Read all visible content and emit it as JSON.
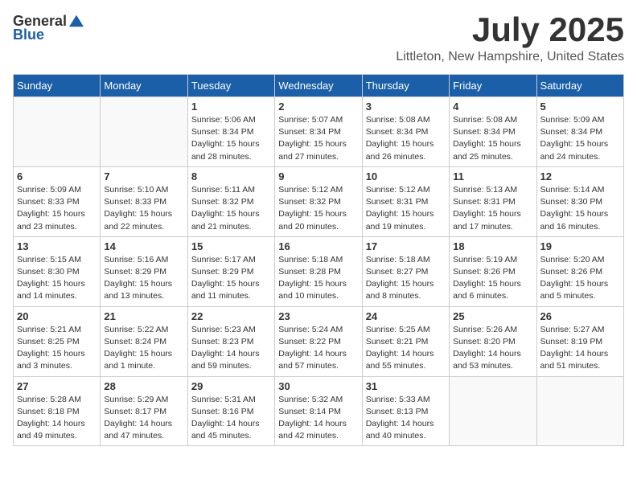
{
  "logo": {
    "general": "General",
    "blue": "Blue"
  },
  "title": "July 2025",
  "location": "Littleton, New Hampshire, United States",
  "weekdays": [
    "Sunday",
    "Monday",
    "Tuesday",
    "Wednesday",
    "Thursday",
    "Friday",
    "Saturday"
  ],
  "weeks": [
    [
      {
        "day": "",
        "info": ""
      },
      {
        "day": "",
        "info": ""
      },
      {
        "day": "1",
        "info": "Sunrise: 5:06 AM\nSunset: 8:34 PM\nDaylight: 15 hours and 28 minutes."
      },
      {
        "day": "2",
        "info": "Sunrise: 5:07 AM\nSunset: 8:34 PM\nDaylight: 15 hours and 27 minutes."
      },
      {
        "day": "3",
        "info": "Sunrise: 5:08 AM\nSunset: 8:34 PM\nDaylight: 15 hours and 26 minutes."
      },
      {
        "day": "4",
        "info": "Sunrise: 5:08 AM\nSunset: 8:34 PM\nDaylight: 15 hours and 25 minutes."
      },
      {
        "day": "5",
        "info": "Sunrise: 5:09 AM\nSunset: 8:34 PM\nDaylight: 15 hours and 24 minutes."
      }
    ],
    [
      {
        "day": "6",
        "info": "Sunrise: 5:09 AM\nSunset: 8:33 PM\nDaylight: 15 hours and 23 minutes."
      },
      {
        "day": "7",
        "info": "Sunrise: 5:10 AM\nSunset: 8:33 PM\nDaylight: 15 hours and 22 minutes."
      },
      {
        "day": "8",
        "info": "Sunrise: 5:11 AM\nSunset: 8:32 PM\nDaylight: 15 hours and 21 minutes."
      },
      {
        "day": "9",
        "info": "Sunrise: 5:12 AM\nSunset: 8:32 PM\nDaylight: 15 hours and 20 minutes."
      },
      {
        "day": "10",
        "info": "Sunrise: 5:12 AM\nSunset: 8:31 PM\nDaylight: 15 hours and 19 minutes."
      },
      {
        "day": "11",
        "info": "Sunrise: 5:13 AM\nSunset: 8:31 PM\nDaylight: 15 hours and 17 minutes."
      },
      {
        "day": "12",
        "info": "Sunrise: 5:14 AM\nSunset: 8:30 PM\nDaylight: 15 hours and 16 minutes."
      }
    ],
    [
      {
        "day": "13",
        "info": "Sunrise: 5:15 AM\nSunset: 8:30 PM\nDaylight: 15 hours and 14 minutes."
      },
      {
        "day": "14",
        "info": "Sunrise: 5:16 AM\nSunset: 8:29 PM\nDaylight: 15 hours and 13 minutes."
      },
      {
        "day": "15",
        "info": "Sunrise: 5:17 AM\nSunset: 8:29 PM\nDaylight: 15 hours and 11 minutes."
      },
      {
        "day": "16",
        "info": "Sunrise: 5:18 AM\nSunset: 8:28 PM\nDaylight: 15 hours and 10 minutes."
      },
      {
        "day": "17",
        "info": "Sunrise: 5:18 AM\nSunset: 8:27 PM\nDaylight: 15 hours and 8 minutes."
      },
      {
        "day": "18",
        "info": "Sunrise: 5:19 AM\nSunset: 8:26 PM\nDaylight: 15 hours and 6 minutes."
      },
      {
        "day": "19",
        "info": "Sunrise: 5:20 AM\nSunset: 8:26 PM\nDaylight: 15 hours and 5 minutes."
      }
    ],
    [
      {
        "day": "20",
        "info": "Sunrise: 5:21 AM\nSunset: 8:25 PM\nDaylight: 15 hours and 3 minutes."
      },
      {
        "day": "21",
        "info": "Sunrise: 5:22 AM\nSunset: 8:24 PM\nDaylight: 15 hours and 1 minute."
      },
      {
        "day": "22",
        "info": "Sunrise: 5:23 AM\nSunset: 8:23 PM\nDaylight: 14 hours and 59 minutes."
      },
      {
        "day": "23",
        "info": "Sunrise: 5:24 AM\nSunset: 8:22 PM\nDaylight: 14 hours and 57 minutes."
      },
      {
        "day": "24",
        "info": "Sunrise: 5:25 AM\nSunset: 8:21 PM\nDaylight: 14 hours and 55 minutes."
      },
      {
        "day": "25",
        "info": "Sunrise: 5:26 AM\nSunset: 8:20 PM\nDaylight: 14 hours and 53 minutes."
      },
      {
        "day": "26",
        "info": "Sunrise: 5:27 AM\nSunset: 8:19 PM\nDaylight: 14 hours and 51 minutes."
      }
    ],
    [
      {
        "day": "27",
        "info": "Sunrise: 5:28 AM\nSunset: 8:18 PM\nDaylight: 14 hours and 49 minutes."
      },
      {
        "day": "28",
        "info": "Sunrise: 5:29 AM\nSunset: 8:17 PM\nDaylight: 14 hours and 47 minutes."
      },
      {
        "day": "29",
        "info": "Sunrise: 5:31 AM\nSunset: 8:16 PM\nDaylight: 14 hours and 45 minutes."
      },
      {
        "day": "30",
        "info": "Sunrise: 5:32 AM\nSunset: 8:14 PM\nDaylight: 14 hours and 42 minutes."
      },
      {
        "day": "31",
        "info": "Sunrise: 5:33 AM\nSunset: 8:13 PM\nDaylight: 14 hours and 40 minutes."
      },
      {
        "day": "",
        "info": ""
      },
      {
        "day": "",
        "info": ""
      }
    ]
  ]
}
